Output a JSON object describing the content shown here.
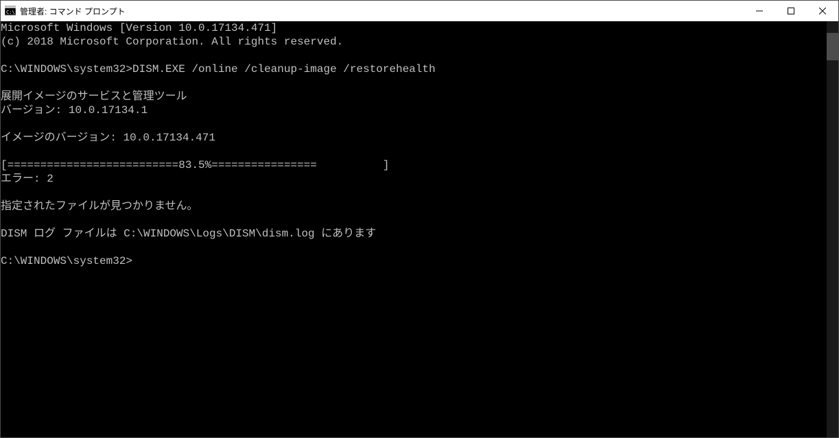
{
  "window": {
    "title": "管理者: コマンド プロンプト"
  },
  "terminal": {
    "lines": {
      "l0": "Microsoft Windows [Version 10.0.17134.471]",
      "l1": "(c) 2018 Microsoft Corporation. All rights reserved.",
      "l2": "",
      "l3": "C:\\WINDOWS\\system32>DISM.EXE /online /cleanup-image /restorehealth",
      "l4": "",
      "l5": "展開イメージのサービスと管理ツール",
      "l6": "バージョン: 10.0.17134.1",
      "l7": "",
      "l8": "イメージのバージョン: 10.0.17134.471",
      "l9": "",
      "l10": "[==========================83.5%================          ]",
      "l11": "エラー: 2",
      "l12": "",
      "l13": "指定されたファイルが見つかりません。",
      "l14": "",
      "l15": "DISM ログ ファイルは C:\\WINDOWS\\Logs\\DISM\\dism.log にあります",
      "l16": "",
      "l17": "C:\\WINDOWS\\system32>"
    }
  }
}
